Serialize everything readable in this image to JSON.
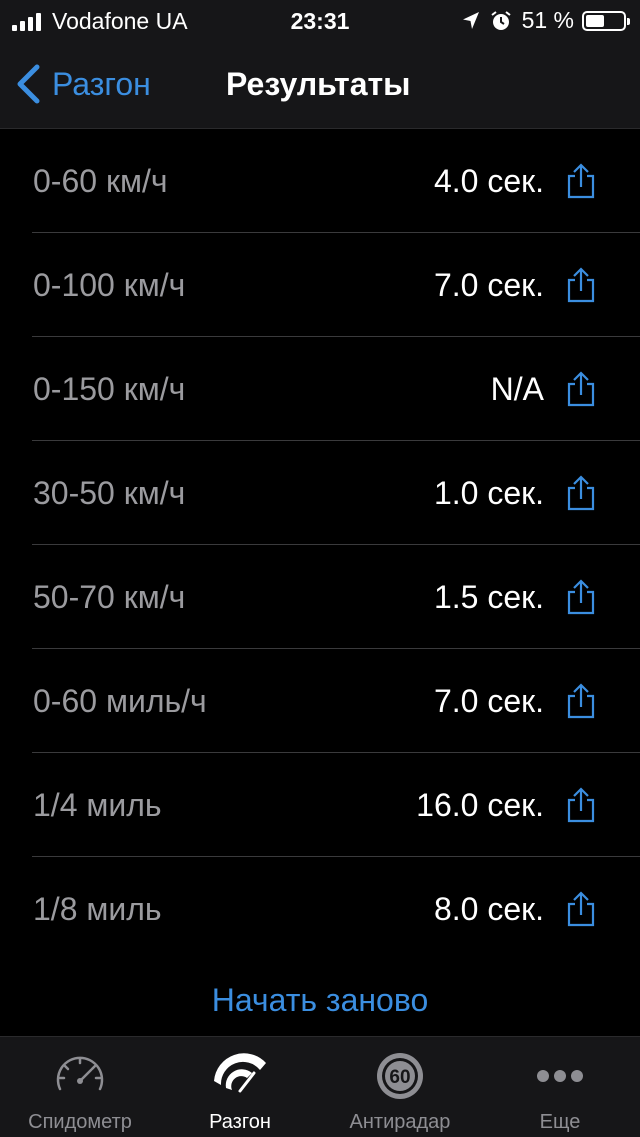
{
  "status_bar": {
    "carrier": "Vodafone UA",
    "time": "23:31",
    "battery": "51 %",
    "battery_level": 0.51
  },
  "nav": {
    "back_label": "Разгон",
    "title": "Результаты"
  },
  "results": [
    {
      "label": "0-60 км/ч",
      "value": "4.0 сек."
    },
    {
      "label": "0-100 км/ч",
      "value": "7.0 сек."
    },
    {
      "label": "0-150 км/ч",
      "value": "N/A"
    },
    {
      "label": "30-50 км/ч",
      "value": "1.0 сек."
    },
    {
      "label": "50-70 км/ч",
      "value": "1.5 сек."
    },
    {
      "label": "0-60 миль/ч",
      "value": "7.0 сек."
    },
    {
      "label": "1/4 миль",
      "value": "16.0 сек."
    },
    {
      "label": "1/8 миль",
      "value": "8.0 сек."
    }
  ],
  "restart_label": "Начать заново",
  "tabs": [
    {
      "label": "Спидометр",
      "icon": "speedometer-icon"
    },
    {
      "label": "Разгон",
      "icon": "acceleration-icon"
    },
    {
      "label": "Антирадар",
      "icon": "radar-60-icon",
      "badge": "60"
    },
    {
      "label": "Еще",
      "icon": "more-icon"
    }
  ],
  "colors": {
    "accent": "#3b8ee0",
    "background": "#000000",
    "bar": "#161618"
  }
}
